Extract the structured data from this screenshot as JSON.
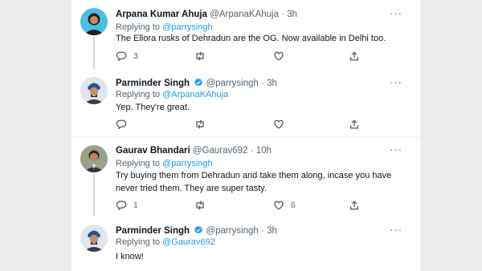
{
  "tweets": [
    {
      "name": "Arpana Kumar Ahuja",
      "handle": "@ArpanaKAhuja",
      "dot": "·",
      "time": "3h",
      "replying_prefix": "Replying to ",
      "replying_to": "@parrysingh",
      "text": "The Ellora rusks of Dehradun are the OG. Now available in Delhi too.",
      "reply_count": "3",
      "retweet_count": "",
      "like_count": "",
      "verified": false
    },
    {
      "name": "Parminder Singh",
      "handle": "@parrysingh",
      "dot": "·",
      "time": "3h",
      "replying_prefix": "Replying to ",
      "replying_to": "@ArpanaKAhuja",
      "text": "Yep. They're great.",
      "reply_count": "",
      "retweet_count": "",
      "like_count": "",
      "verified": true
    },
    {
      "name": "Gaurav Bhandari",
      "handle": "@Gaurav692",
      "dot": "·",
      "time": "10h",
      "replying_prefix": "Replying to ",
      "replying_to": "@parrysingh",
      "text": "Try buying them from Dehradun and take them along, incase you have never tried them. They are super tasty.",
      "reply_count": "1",
      "retweet_count": "",
      "like_count": "6",
      "verified": false
    },
    {
      "name": "Parminder Singh",
      "handle": "@parrysingh",
      "dot": "·",
      "time": "3h",
      "replying_prefix": "Replying to ",
      "replying_to": "@Gaurav692",
      "text": "I know!",
      "verified": true
    }
  ],
  "more_glyph": "···",
  "icons": {
    "reply": "reply-icon",
    "retweet": "retweet-icon",
    "like": "heart-icon",
    "share": "share-icon",
    "verified": "verified-badge-icon",
    "more": "more-icon"
  },
  "colors": {
    "accent": "#1d9bf0",
    "text": "#0f1419",
    "muted": "#536471",
    "thread_line": "#cfd9de"
  }
}
